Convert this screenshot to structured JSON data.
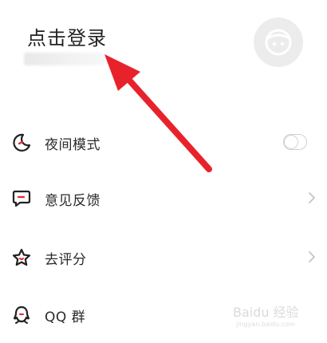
{
  "header": {
    "title": "点击登录"
  },
  "menu": [
    {
      "label": "夜间模式",
      "icon": "moon-icon",
      "control": "toggle",
      "toggle_on": false
    },
    {
      "label": "意见反馈",
      "icon": "feedback-icon",
      "control": "chevron"
    },
    {
      "label": "去评分",
      "icon": "star-icon",
      "control": "chevron"
    },
    {
      "label": "QQ 群",
      "icon": "qq-icon",
      "control": "none"
    }
  ],
  "annotation": {
    "color": "#e8222b"
  },
  "watermark": {
    "text": "Baidu 经验",
    "sub": "jingyan.baidu.com"
  }
}
